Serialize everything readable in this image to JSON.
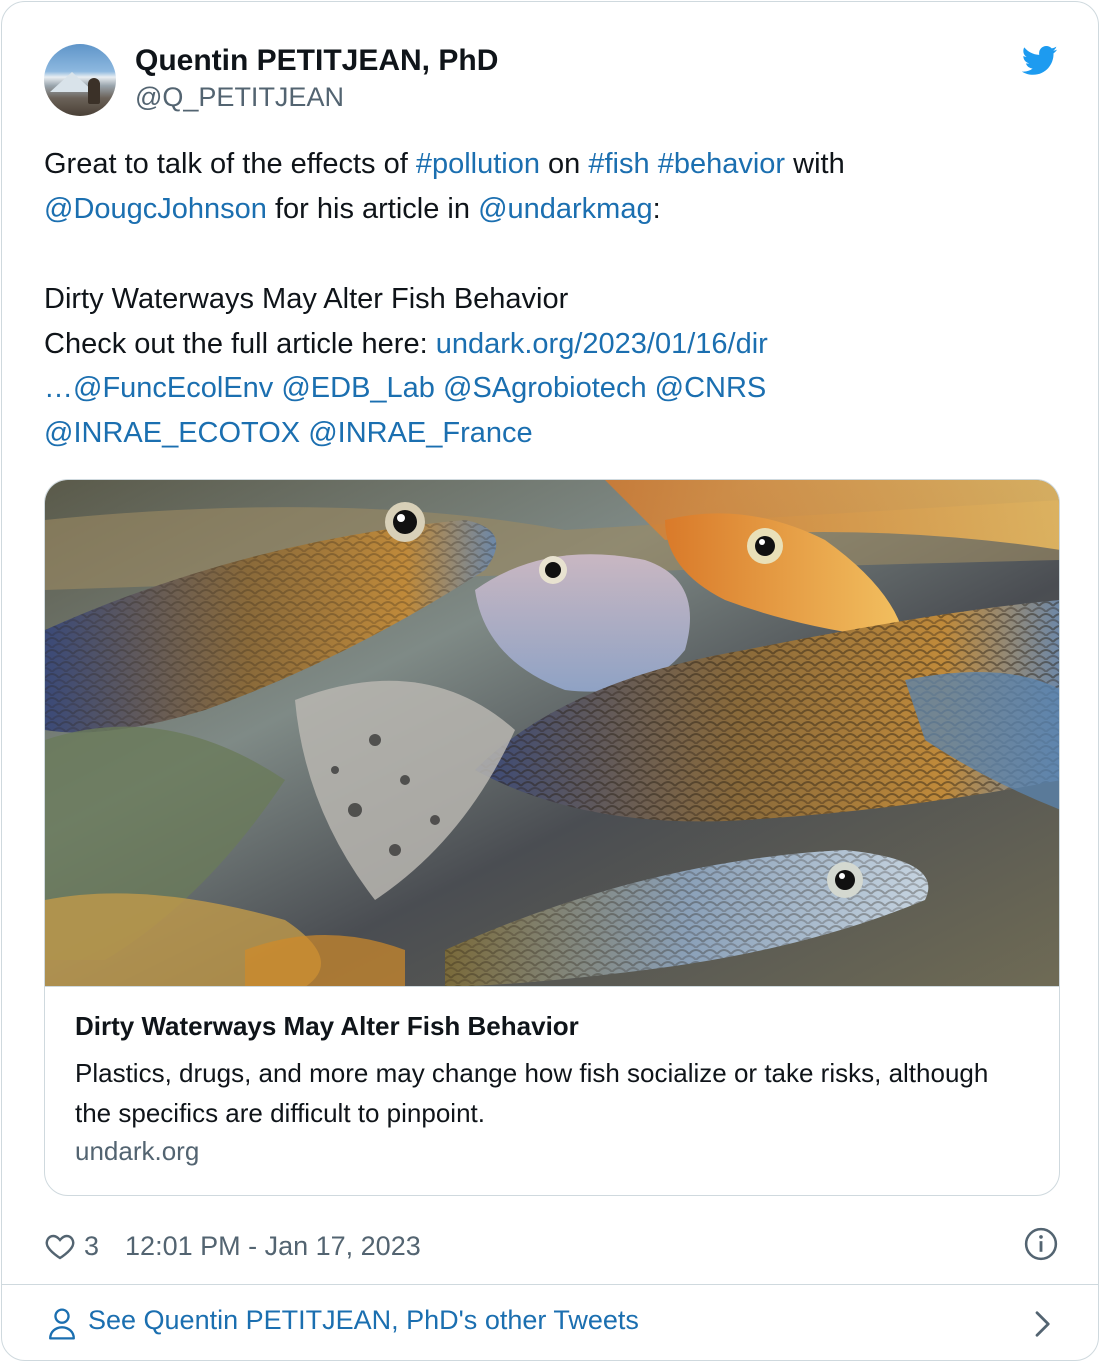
{
  "author": {
    "name": "Quentin PETITJEAN, PhD",
    "handle": "@Q_PETITJEAN",
    "avatar_icon": "profile-photo-mountain"
  },
  "tweet": {
    "line1": {
      "t1": "Great to talk of the effects of ",
      "l1": "#pollution",
      "t2": " on ",
      "l2": "#fish",
      "t3": " ",
      "l3": "#behavior",
      "t4": " with"
    },
    "line2": {
      "l1": "@DougcJohnson",
      "t1": " for his article in ",
      "l2": "@undarkmag",
      "t2": ":"
    },
    "line3": "Dirty Waterways May Alter Fish Behavior",
    "line4": {
      "t1": "Check out the full article here: ",
      "l1": "undark.org/2023/01/16/dir"
    },
    "line5": {
      "l1": "…@FuncEcolEnv",
      "l2": "@EDB_Lab",
      "l3": "@SAgrobiotech",
      "l4": "@CNRS"
    },
    "line6": {
      "l1": "@INRAE_ECOTOX",
      "l2": "@INRAE_France"
    }
  },
  "link_card": {
    "image_subject": "guppy fish photo",
    "title": "Dirty Waterways May Alter Fish Behavior",
    "description": "Plastics, drugs, and more may change how fish socialize or take risks, although the specifics are difficult to pinpoint.",
    "domain": "undark.org"
  },
  "actions": {
    "like_count": "3",
    "timestamp": "12:01 PM - Jan 17, 2023"
  },
  "footer": {
    "label": "See Quentin PETITJEAN, PhD's other Tweets"
  },
  "colors": {
    "link": "#1b6fb0",
    "twitter_blue": "#1d9bf0",
    "secondary_text": "#536471",
    "border": "#cfd9de"
  }
}
